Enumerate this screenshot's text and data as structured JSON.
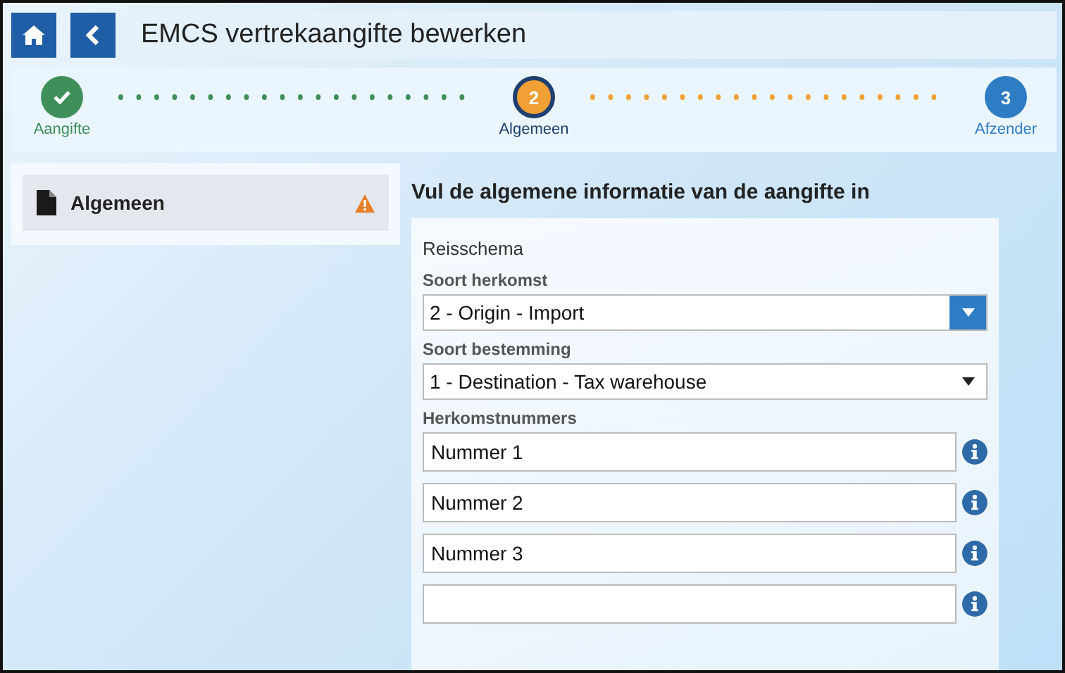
{
  "header": {
    "title": "EMCS vertrekaangifte bewerken"
  },
  "steps": [
    {
      "label": "Aangifte",
      "completed": true,
      "selected": false
    },
    {
      "number": "2",
      "label": "Algemeen",
      "completed": false,
      "selected": true
    },
    {
      "number": "3",
      "label": "Afzender",
      "completed": false,
      "selected": false
    }
  ],
  "sidebar": {
    "items": [
      {
        "label": "Algemeen",
        "selected": true,
        "warning": true
      }
    ]
  },
  "main": {
    "heading": "Vul de algemene informatie van de aangifte in",
    "section": "Reisschema",
    "selects": [
      {
        "label": "Soort herkomst",
        "value": "2 - Origin - Import",
        "focused": true
      },
      {
        "label": "Soort bestemming",
        "value": "1 - Destination - Tax warehouse",
        "focused": false
      }
    ],
    "numbers": {
      "label": "Herkomstnummers",
      "fields": [
        {
          "value": "Nummer 1"
        },
        {
          "value": "Nummer 2"
        },
        {
          "value": "Nummer 3"
        }
      ],
      "blank_field": true
    }
  }
}
